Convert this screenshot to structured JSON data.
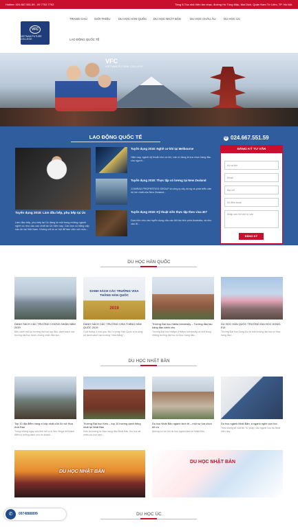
{
  "topbar": {
    "hotline": "Hotline: 024.667.551.59 - 09 7702 7702",
    "address": "Tầng 5-Tòa nhà Viện âm nhạc, đường Hồ Tùng Mậu, Mai Dịch, Quận Nam Từ Liêm, TP. Hà Nội."
  },
  "logo": {
    "mark": "VFC",
    "text": "VIETNAM FUTURE COLLEGE"
  },
  "nav": {
    "home": "TRANG CHỦ",
    "about": "GIỚI THIỆU",
    "korea": "DU HỌC HÀN QUỐC",
    "japan": "DU HỌC NHẬT BẢN",
    "eu": "DU HỌC CHÂU ÂU",
    "abroad": "DU HỌC ÚC",
    "labor": "LAO ĐỘNG QUỐC TẾ"
  },
  "hero": {
    "brand": "VFC",
    "tagline": "VIETNAM FUTURE COLLEGE"
  },
  "labor": {
    "section_title": "LAO ĐỘNG QUỐC TẾ",
    "main_title": "Tuyển dụng 2018: Làm đầu bếp, phụ bếp tại Úc",
    "main_desc": "Làm đầu bếp, phụ bếp tại Úc đang là một trong những ngành nghề có nhu cầu cao nhất tại Úc hiện nay. Các bạn có bằng cấp nấu ăn tại Việt Nam. Không chỉ là cơ hội để làm việc với mức...",
    "items": [
      {
        "title": "Tuyển dụng 2018: Nghề cơ khí tại Melbourne",
        "desc": "Hiện nay, ngành kỹ thuật như cơ khí, hàn xì đang là lựa chọn hàng đầu cho người..."
      },
      {
        "title": "Tuyển dụng 2018: Thực tập có lương tại New Zealand",
        "desc": "COMRAD PROPERTIES GROUP là công ty xây dựng và phát triển căn hộ lớn nhất của New Zealand..."
      },
      {
        "title": "Tuyển dụng 2018: Kỹ thuật viên thực tập theo visa 407",
        "desc": "Dựa trên nhu cầu tuyển dụng của các đối tác bên phía Australia, và nhu cầu đi..."
      }
    ]
  },
  "contact": {
    "hotline": "024.667.551.59",
    "form_title": "ĐĂNG KÝ TƯ VẤN",
    "name_ph": "Họ và tên",
    "email_ph": "Email",
    "address_ph": "Địa chỉ",
    "phone_ph": "Số điện thoại",
    "question_ph": "Nhập câu hỏi cần tư vấn",
    "submit": "ĐĂNG KÝ"
  },
  "korea": {
    "title": "DU HỌC HÀN QUỐC",
    "cards": [
      {
        "title": "DANH SÁCH CÁC TRƯỜNG CHỨNG NHẬN NĂM 2019",
        "desc": "Bên cạnh một số trường đại học top đầu, danh sách các trường đại học được chứng nhận đào tạo..."
      },
      {
        "title": "DANH SÁCH CÁC TRƯỜNG VISA THẲNG HÀN QUỐC 2019",
        "desc": "Cuối tháng 4 vừa qua, Bộ Tư pháp Hàn Quốc vừa công bố danh sách các trường \"visa thẳng\"...",
        "img_text": "DANH SÁCH CÁC TRƯỜNG VISA THẲNG HÀN QUỐC",
        "img_year": "2019"
      },
      {
        "title": "Trường Đại học Hallia University – Trường đào tạo hàng đầu dành cho",
        "desc": "Trường Đại học Hallym (Hallym University) là một trong những trường đại học tư thục hàng đầu..."
      },
      {
        "title": "DU HỌC HÀN QUỐC TRƯỜNG ĐẠI HỌC DONG-EUI",
        "desc": "Trường Đại học Dong-Eui là một trường đại học tư thục hàng đầu..."
      }
    ]
  },
  "japan": {
    "title": "DU HỌC NHẬT BẢN",
    "cards": [
      {
        "title": "Top 10 địa điểm hàng vi hấp nhất của Xứ sở Hoa Anh Đào",
        "desc": "Trong những ngày của thời tiết oi ả, tỉnh Shiga trở thành điểm lý tưởng dành cho du khách..."
      },
      {
        "title": "Trường Đại học Keio – top 10 trường danh tiếng nhất tại Nhật Bản",
        "desc": "Keio là trường tư thục hàng đầu Nhật Bản, thu hút rất nhiều du học sinh..."
      },
      {
        "title": "Du học Nhật Bản ngành kinh tế – một sự lựa chọn tối ưu",
        "desc": "Những lợi ích khi du học ngành kinh tế Nhật Bản..."
      },
      {
        "title": "Du học ngành Nhật Bản: à ngành nghề cực hot",
        "desc": "Theo thống kê của Bộ Tư pháp, các ngành học tại Nhật hiện nay..."
      }
    ],
    "banner1": "DU HỌC NHẬT BẢN",
    "banner2": "DU HỌC NHẬT BẢN"
  },
  "australia": {
    "title": "DU HỌC ÚC"
  },
  "callbox": {
    "number": "0974888899"
  },
  "colors": {
    "accent": "#c8102e",
    "primary": "#2f5d9e"
  }
}
